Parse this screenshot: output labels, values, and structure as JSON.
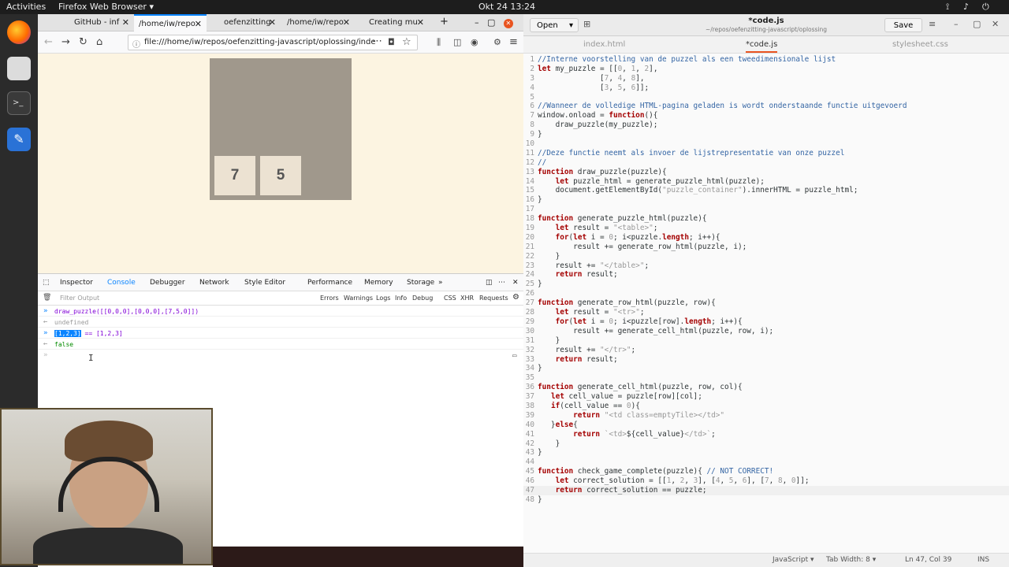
{
  "topbar": {
    "activities": "Activities",
    "app": "Firefox Web Browser ▾",
    "clock": "Okt 24  13:24"
  },
  "browser": {
    "tabs": [
      "GitHub - inf",
      "/home/iw/repo",
      "oefenzitting",
      "/home/iw/repo",
      "Creating mu"
    ],
    "url": "file:///home/iw/repos/oefenzitting-javascript/oplossing/inde",
    "tiles": [
      "7",
      "5"
    ],
    "devtools_tabs": [
      "Inspector",
      "Console",
      "Debugger",
      "Network",
      "Style Editor",
      "Performance",
      "Memory",
      "Storage"
    ],
    "filter_placeholder": "Filter Output",
    "filter_buttons": [
      "Errors",
      "Warnings",
      "Logs",
      "Info",
      "Debug",
      "CSS",
      "XHR",
      "Requests"
    ],
    "console": [
      {
        "type": "in",
        "text": "draw_puzzle([[0,0,0],[0,0,0],[7,5,0]])"
      },
      {
        "type": "out",
        "text": "undefined"
      },
      {
        "type": "in",
        "selected": "[1,2,3]",
        "text": " == [1,2,3]"
      },
      {
        "type": "out",
        "text": "false"
      }
    ]
  },
  "editor": {
    "open_label": "Open",
    "title": "*code.js",
    "subtitle": "~/repos/oefenzitting-javascript/oplossing",
    "save_label": "Save",
    "tabs": [
      "index.html",
      "*code.js",
      "stylesheet.css"
    ],
    "colors": {
      "keyword": "#a40000",
      "string": "#999999",
      "comment": "#3465a4",
      "number": "#999999"
    },
    "lines": [
      [
        [
          "c",
          "//Interne voorstelling van de puzzel als een tweedimensionale lijst"
        ]
      ],
      [
        [
          "k",
          "let"
        ],
        [
          "t",
          " my_puzzle = [["
        ],
        [
          "n",
          "0"
        ],
        [
          "t",
          ", "
        ],
        [
          "n",
          "1"
        ],
        [
          "t",
          ", "
        ],
        [
          "n",
          "2"
        ],
        [
          "t",
          "],"
        ]
      ],
      [
        [
          "t",
          "              ["
        ],
        [
          "n",
          "7"
        ],
        [
          "t",
          ", "
        ],
        [
          "n",
          "4"
        ],
        [
          "t",
          ", "
        ],
        [
          "n",
          "8"
        ],
        [
          "t",
          "],"
        ]
      ],
      [
        [
          "t",
          "              ["
        ],
        [
          "n",
          "3"
        ],
        [
          "t",
          ", "
        ],
        [
          "n",
          "5"
        ],
        [
          "t",
          ", "
        ],
        [
          "n",
          "6"
        ],
        [
          "t",
          "]];"
        ]
      ],
      [
        [
          "t",
          ""
        ]
      ],
      [
        [
          "c",
          "//Wanneer de volledige HTML-pagina geladen is wordt onderstaande functie uitgevoerd"
        ]
      ],
      [
        [
          "t",
          "window.onload = "
        ],
        [
          "k",
          "function"
        ],
        [
          "t",
          "(){"
        ]
      ],
      [
        [
          "t",
          "    draw_puzzle(my_puzzle);"
        ]
      ],
      [
        [
          "t",
          "}"
        ]
      ],
      [
        [
          "t",
          ""
        ]
      ],
      [
        [
          "c",
          "//Deze functie neemt als invoer de lijstrepresentatie van onze puzzel"
        ]
      ],
      [
        [
          "c",
          "//"
        ]
      ],
      [
        [
          "k",
          "function"
        ],
        [
          "t",
          " draw_puzzle(puzzle){"
        ]
      ],
      [
        [
          "t",
          "    "
        ],
        [
          "k",
          "let"
        ],
        [
          "t",
          " puzzle_html = generate_puzzle_html(puzzle);"
        ]
      ],
      [
        [
          "t",
          "    document.getElementById("
        ],
        [
          "s",
          "\"puzzle_container\""
        ],
        [
          "t",
          ").innerHTML = puzzle_html;"
        ]
      ],
      [
        [
          "t",
          "}"
        ]
      ],
      [
        [
          "t",
          ""
        ]
      ],
      [
        [
          "k",
          "function"
        ],
        [
          "t",
          " generate_puzzle_html(puzzle){"
        ]
      ],
      [
        [
          "t",
          "    "
        ],
        [
          "k",
          "let"
        ],
        [
          "t",
          " result = "
        ],
        [
          "s",
          "\"<table>\""
        ],
        [
          "t",
          ";"
        ]
      ],
      [
        [
          "t",
          "    "
        ],
        [
          "k",
          "for"
        ],
        [
          "t",
          "("
        ],
        [
          "k",
          "let"
        ],
        [
          "t",
          " i = "
        ],
        [
          "n",
          "0"
        ],
        [
          "t",
          "; i<puzzle."
        ],
        [
          "k",
          "length"
        ],
        [
          "t",
          "; i++){"
        ]
      ],
      [
        [
          "t",
          "        result += generate_row_html(puzzle, i);"
        ]
      ],
      [
        [
          "t",
          "    }"
        ]
      ],
      [
        [
          "t",
          "    result += "
        ],
        [
          "s",
          "\"</table>\""
        ],
        [
          "t",
          ";"
        ]
      ],
      [
        [
          "t",
          "    "
        ],
        [
          "k",
          "return"
        ],
        [
          "t",
          " result;"
        ]
      ],
      [
        [
          "t",
          "}"
        ]
      ],
      [
        [
          "t",
          ""
        ]
      ],
      [
        [
          "k",
          "function"
        ],
        [
          "t",
          " generate_row_html(puzzle, row){"
        ]
      ],
      [
        [
          "t",
          "    "
        ],
        [
          "k",
          "let"
        ],
        [
          "t",
          " result = "
        ],
        [
          "s",
          "\"<tr>\""
        ],
        [
          "t",
          ";"
        ]
      ],
      [
        [
          "t",
          "    "
        ],
        [
          "k",
          "for"
        ],
        [
          "t",
          "("
        ],
        [
          "k",
          "let"
        ],
        [
          "t",
          " i = "
        ],
        [
          "n",
          "0"
        ],
        [
          "t",
          "; i<puzzle[row]."
        ],
        [
          "k",
          "length"
        ],
        [
          "t",
          "; i++){"
        ]
      ],
      [
        [
          "t",
          "        result += generate_cell_html(puzzle, row, i);"
        ]
      ],
      [
        [
          "t",
          "    }"
        ]
      ],
      [
        [
          "t",
          "    result += "
        ],
        [
          "s",
          "\"</tr>\""
        ],
        [
          "t",
          ";"
        ]
      ],
      [
        [
          "t",
          "    "
        ],
        [
          "k",
          "return"
        ],
        [
          "t",
          " result;"
        ]
      ],
      [
        [
          "t",
          "}"
        ]
      ],
      [
        [
          "t",
          ""
        ]
      ],
      [
        [
          "k",
          "function"
        ],
        [
          "t",
          " generate_cell_html(puzzle, row, col){"
        ]
      ],
      [
        [
          "t",
          "   "
        ],
        [
          "k",
          "let"
        ],
        [
          "t",
          " cell_value = puzzle[row][col];"
        ]
      ],
      [
        [
          "t",
          "   "
        ],
        [
          "k",
          "if"
        ],
        [
          "t",
          "(cell_value == "
        ],
        [
          "n",
          "0"
        ],
        [
          "t",
          "){"
        ]
      ],
      [
        [
          "t",
          "        "
        ],
        [
          "k",
          "return"
        ],
        [
          "t",
          " "
        ],
        [
          "s",
          "\"<td class=emptyTile></td>\""
        ]
      ],
      [
        [
          "t",
          "   }"
        ],
        [
          "k",
          "else"
        ],
        [
          "t",
          "{"
        ]
      ],
      [
        [
          "t",
          "        "
        ],
        [
          "k",
          "return"
        ],
        [
          "t",
          " "
        ],
        [
          "s",
          "`<td>"
        ],
        [
          "t",
          "${cell_value}"
        ],
        [
          "s",
          "</td>`"
        ],
        [
          "t",
          ";"
        ]
      ],
      [
        [
          "t",
          "    }"
        ]
      ],
      [
        [
          "t",
          "}"
        ]
      ],
      [
        [
          "t",
          ""
        ]
      ],
      [
        [
          "k",
          "function"
        ],
        [
          "t",
          " check_game_complete(puzzle){ "
        ],
        [
          "c",
          "// NOT CORRECT!"
        ]
      ],
      [
        [
          "t",
          "    "
        ],
        [
          "k",
          "let"
        ],
        [
          "t",
          " correct_solution = [["
        ],
        [
          "n",
          "1"
        ],
        [
          "t",
          ", "
        ],
        [
          "n",
          "2"
        ],
        [
          "t",
          ", "
        ],
        [
          "n",
          "3"
        ],
        [
          "t",
          "], ["
        ],
        [
          "n",
          "4"
        ],
        [
          "t",
          ", "
        ],
        [
          "n",
          "5"
        ],
        [
          "t",
          ", "
        ],
        [
          "n",
          "6"
        ],
        [
          "t",
          "], ["
        ],
        [
          "n",
          "7"
        ],
        [
          "t",
          ", "
        ],
        [
          "n",
          "8"
        ],
        [
          "t",
          ", "
        ],
        [
          "n",
          "0"
        ],
        [
          "t",
          "]];"
        ]
      ],
      [
        [
          "t",
          "    "
        ],
        [
          "k",
          "return"
        ],
        [
          "t",
          " correct_solution == puzzle;"
        ]
      ],
      [
        [
          "t",
          "}"
        ]
      ]
    ],
    "current_line": 47,
    "status": {
      "lang": "JavaScript ▾",
      "tab": "Tab Width: 8 ▾",
      "pos": "Ln 47, Col 39",
      "ins": "INS"
    }
  }
}
